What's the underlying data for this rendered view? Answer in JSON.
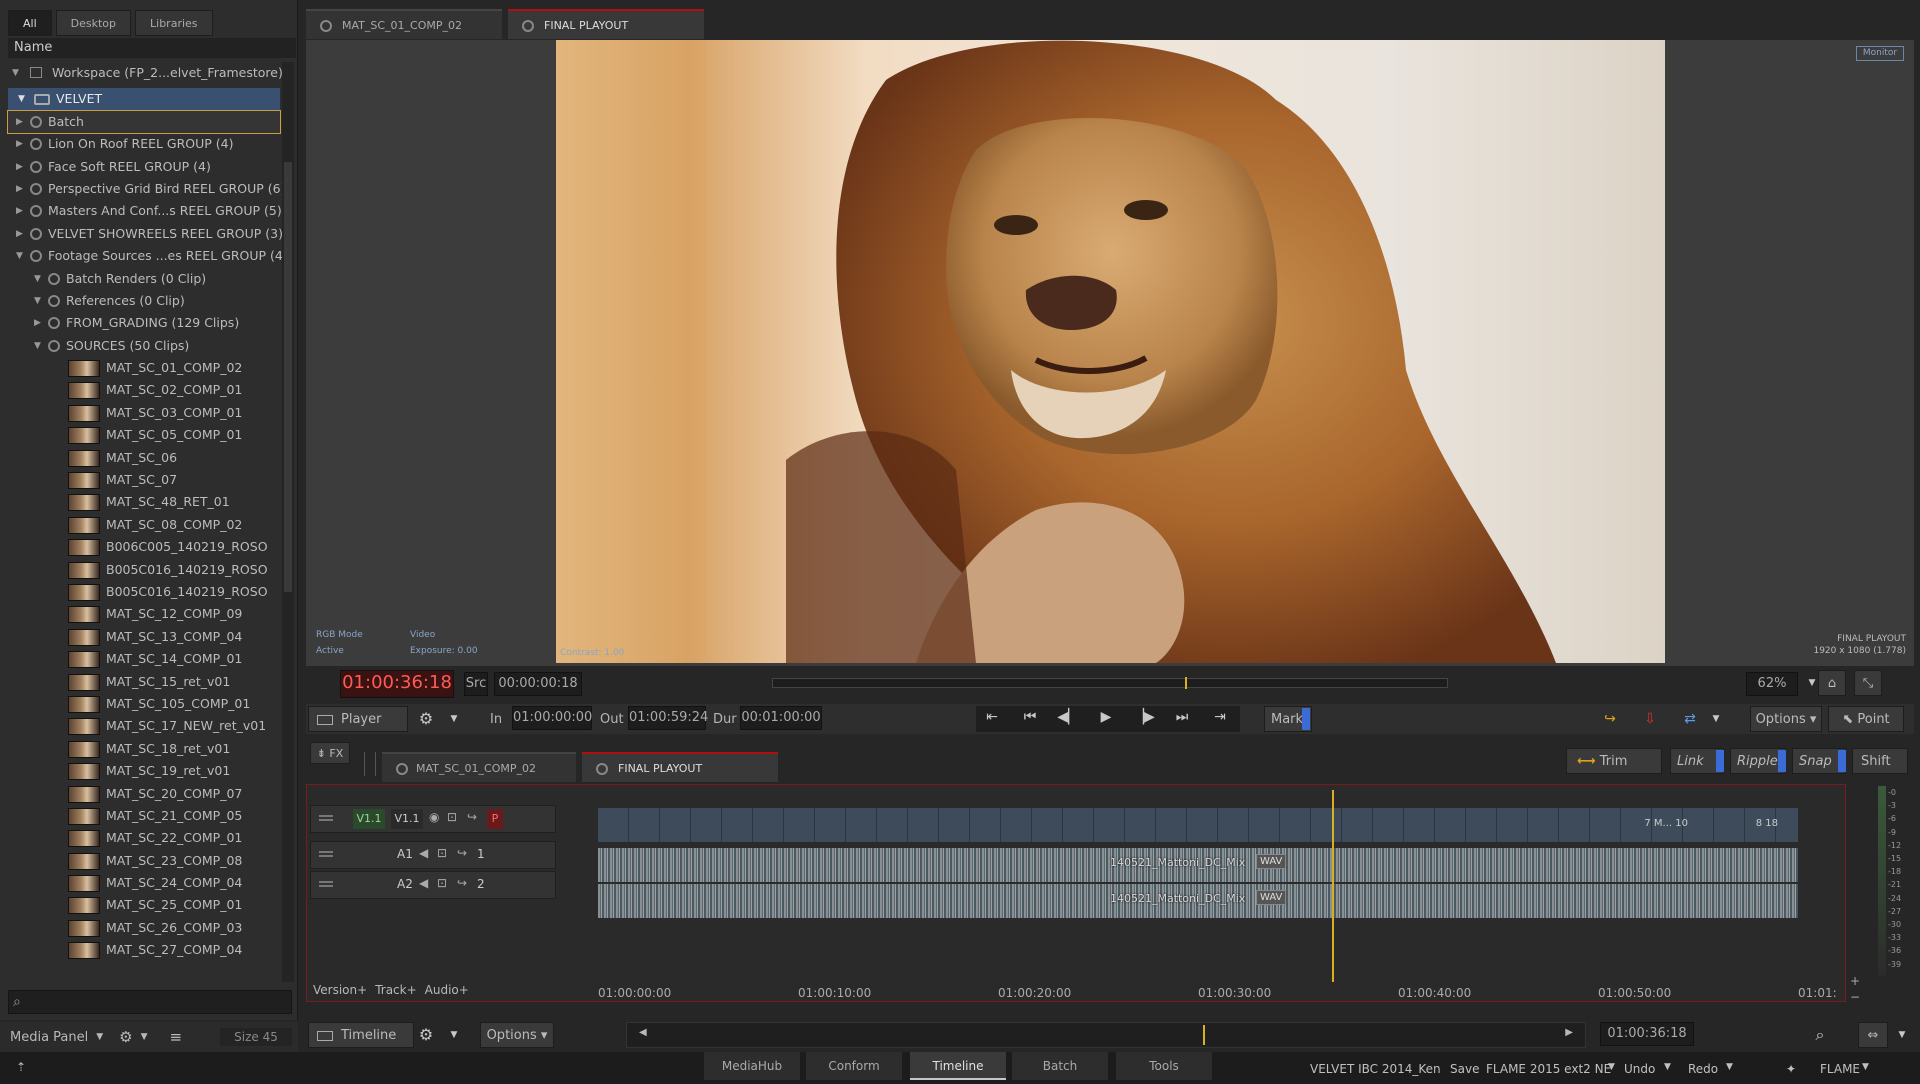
{
  "left_panel": {
    "tabs": [
      "All",
      "Desktop",
      "Libraries"
    ],
    "column_header": "Name",
    "workspace": "Workspace (FP_2...elvet_Framestore)",
    "library": "VELVET",
    "items": [
      {
        "label": "Batch",
        "type": "batch"
      },
      {
        "label": "Lion On Roof REEL GROUP (4)",
        "type": "reelgroup"
      },
      {
        "label": "Face Soft REEL GROUP (4)",
        "type": "reelgroup"
      },
      {
        "label": "Perspective Grid Bird REEL GROUP (6)",
        "type": "reelgroup"
      },
      {
        "label": "Masters And Conf...s REEL GROUP (5)",
        "type": "reelgroup"
      },
      {
        "label": "VELVET SHOWREELS REEL GROUP (3)",
        "type": "reelgroup"
      },
      {
        "label": "Footage Sources ...es REEL GROUP (4)",
        "type": "reelgroup-open"
      },
      {
        "label": "Batch Renders (0 Clip)",
        "type": "reel"
      },
      {
        "label": "References (0 Clip)",
        "type": "reel"
      },
      {
        "label": "FROM_GRADING (129 Clips)",
        "type": "reel-closed"
      },
      {
        "label": "SOURCES (50 Clips)",
        "type": "reel"
      },
      {
        "label": "MAT_SC_01_COMP_02",
        "type": "clip"
      },
      {
        "label": "MAT_SC_02_COMP_01",
        "type": "clip"
      },
      {
        "label": "MAT_SC_03_COMP_01",
        "type": "clip"
      },
      {
        "label": "MAT_SC_05_COMP_01",
        "type": "clip"
      },
      {
        "label": "MAT_SC_06",
        "type": "clip"
      },
      {
        "label": "MAT_SC_07",
        "type": "clip"
      },
      {
        "label": "MAT_SC_48_RET_01",
        "type": "clip"
      },
      {
        "label": "MAT_SC_08_COMP_02",
        "type": "clip"
      },
      {
        "label": "B006C005_140219_ROSO",
        "type": "clip"
      },
      {
        "label": "B005C016_140219_ROSO",
        "type": "clip"
      },
      {
        "label": "B005C016_140219_ROSO",
        "type": "clip"
      },
      {
        "label": "MAT_SC_12_COMP_09",
        "type": "clip"
      },
      {
        "label": "MAT_SC_13_COMP_04",
        "type": "clip"
      },
      {
        "label": "MAT_SC_14_COMP_01",
        "type": "clip"
      },
      {
        "label": "MAT_SC_15_ret_v01",
        "type": "clip"
      },
      {
        "label": "MAT_SC_105_COMP_01",
        "type": "clip"
      },
      {
        "label": "MAT_SC_17_NEW_ret_v01",
        "type": "clip"
      },
      {
        "label": "MAT_SC_18_ret_v01",
        "type": "clip"
      },
      {
        "label": "MAT_SC_19_ret_v01",
        "type": "clip"
      },
      {
        "label": "MAT_SC_20_COMP_07",
        "type": "clip"
      },
      {
        "label": "MAT_SC_21_COMP_05",
        "type": "clip"
      },
      {
        "label": "MAT_SC_22_COMP_01",
        "type": "clip"
      },
      {
        "label": "MAT_SC_23_COMP_08",
        "type": "clip"
      },
      {
        "label": "MAT_SC_24_COMP_04",
        "type": "clip"
      },
      {
        "label": "MAT_SC_25_COMP_01",
        "type": "clip"
      },
      {
        "label": "MAT_SC_26_COMP_03",
        "type": "clip"
      },
      {
        "label": "MAT_SC_27_COMP_04",
        "type": "clip"
      }
    ],
    "bottom": {
      "panel": "Media Panel",
      "size": "Size 45"
    }
  },
  "viewer": {
    "tabs": [
      "MAT_SC_01_COMP_02",
      "FINAL PLAYOUT"
    ],
    "monitor_label": "Monitor",
    "overlay": {
      "rgb_mode": "RGB Mode",
      "active": "Active",
      "video": "Video",
      "exposure": "Exposure: 0.00",
      "contrast": "Contrast: 1.00",
      "clip_name": "FINAL PLAYOUT",
      "resolution": "1920 x 1080 (1.778)"
    },
    "timecode": "01:00:36:18",
    "src": "Src",
    "src_tc": "00:00:00:18",
    "zoom": "62%"
  },
  "player_bar": {
    "player": "Player",
    "in_label": "In",
    "in": "01:00:00:00",
    "out_label": "Out",
    "out": "01:00:59:24",
    "dur_label": "Dur",
    "dur": "00:01:00:00",
    "mark": "Mark",
    "options": "Options",
    "point": "Point"
  },
  "timeline": {
    "fx": "FX",
    "tabs": [
      "MAT_SC_01_COMP_02",
      "FINAL PLAYOUT"
    ],
    "modes": {
      "trim": "Trim",
      "link": "Link",
      "ripple": "Ripple",
      "snap": "Snap",
      "shift": "Shift"
    },
    "tracks": [
      {
        "src": "V1.1",
        "dst": "V1.1",
        "flag": "P"
      },
      {
        "name": "A1",
        "num": "1"
      },
      {
        "name": "A2",
        "num": "2"
      }
    ],
    "audio_clip": "140521_Mattoni_DC_Mix",
    "audio_badge": "WAV",
    "video_end_labels": {
      "m": "7 M... 10",
      "b": "8  18"
    },
    "ruler": [
      "01:00:00:00",
      "01:00:10:00",
      "01:00:20:00",
      "01:00:30:00",
      "01:00:40:00",
      "01:00:50:00",
      "01:01:"
    ],
    "footer": [
      "Version+",
      "Track+",
      "Audio+"
    ],
    "meter_ticks": [
      "-0",
      "-3",
      "-6",
      "-9",
      "-12",
      "-15",
      "-18",
      "-21",
      "-24",
      "-27",
      "-30",
      "-33",
      "-36",
      "-39"
    ],
    "bottom": {
      "timeline": "Timeline",
      "options": "Options",
      "tc": "01:00:36:18"
    }
  },
  "bottom_bar": {
    "tabs": [
      "MediaHub",
      "Conform",
      "Timeline",
      "Batch",
      "Tools"
    ],
    "active": "Timeline",
    "project": "VELVET IBC 2014_Ken",
    "save": "Save",
    "version": "FLAME 2015 ext2 NE",
    "undo": "Undo",
    "redo": "Redo",
    "app": "FLAME"
  },
  "colors": {
    "accent_red": "#b01010",
    "selection": "#3a5071",
    "timecode_red": "#ff5b55",
    "playhead": "#d8b020",
    "mark_blue": "#3b6bd6"
  }
}
